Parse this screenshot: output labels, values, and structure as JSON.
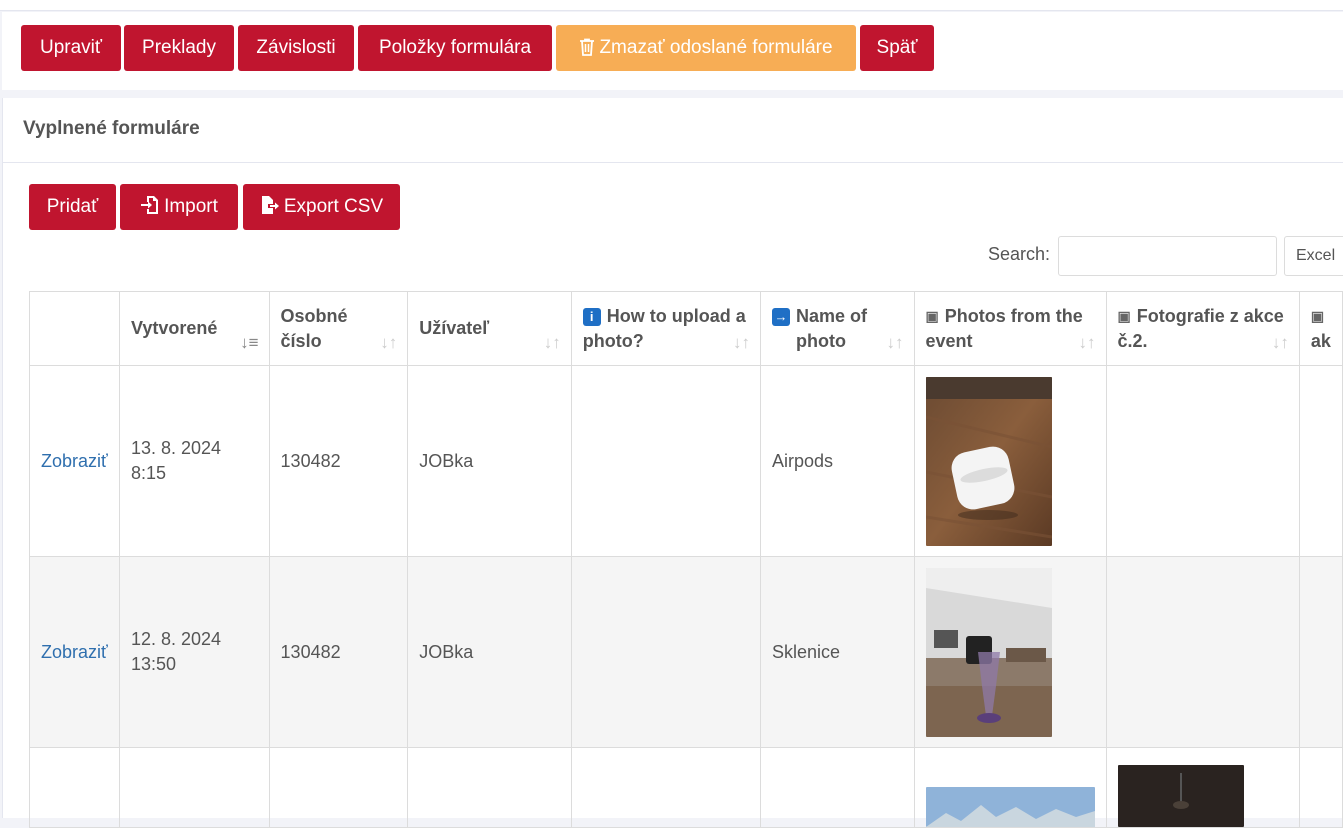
{
  "toolbar": {
    "edit": "Upraviť",
    "translations": "Preklady",
    "dependencies": "Závislosti",
    "form_items": "Položky formulára",
    "delete_submitted": "Zmazať odoslané formuláre",
    "back": "Späť"
  },
  "panel": {
    "title": "Vyplnené formuláre",
    "add": "Pridať",
    "import": "Import",
    "export_csv": "Export CSV",
    "search_label": "Search:",
    "search_value": "",
    "excel": "Excel"
  },
  "table": {
    "headers": [
      "",
      "Vytvorené",
      "Osobné číslo",
      "Užívateľ",
      "How to upload a photo?",
      "Name of photo",
      "Photos from the event",
      "Fotografie z akce č.2.",
      "ak"
    ],
    "rows": [
      {
        "action": "Zobraziť",
        "created": "13. 8. 2024 8:15",
        "personal_number": "130482",
        "user": "JOBka",
        "how_to": "",
        "name": "Airpods"
      },
      {
        "action": "Zobraziť",
        "created": "12. 8. 2024 13:50",
        "personal_number": "130482",
        "user": "JOBka",
        "how_to": "",
        "name": "Sklenice"
      },
      {
        "action": "",
        "created": "",
        "personal_number": "",
        "user": "",
        "how_to": "",
        "name": ""
      }
    ]
  },
  "colors": {
    "primary": "#c0152f",
    "warning": "#f7ad55",
    "link": "#2f6fae"
  },
  "icons": [
    "trash-icon",
    "import-icon",
    "export-icon",
    "info-icon",
    "arrow-right-icon",
    "image-icon",
    "sort-icon"
  ]
}
